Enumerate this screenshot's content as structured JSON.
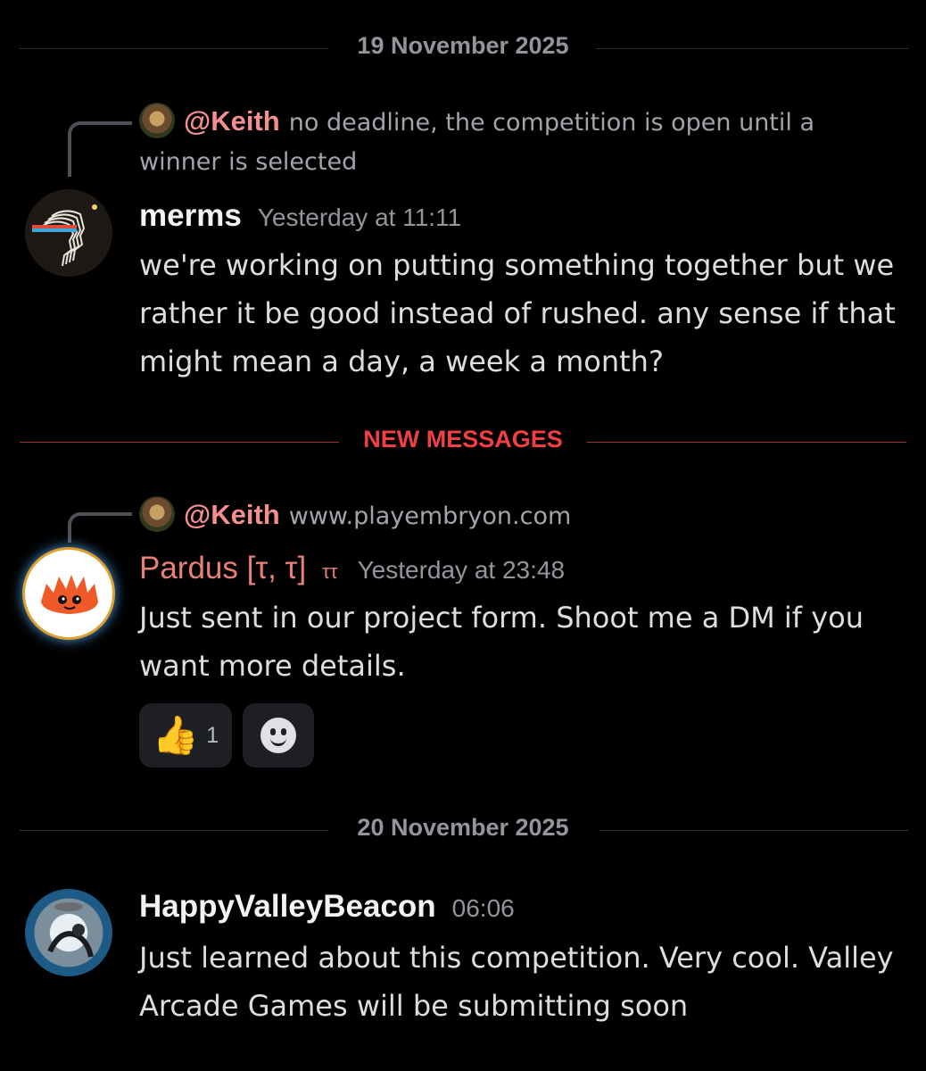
{
  "dividers": {
    "date1": "19 November 2025",
    "new": "NEW MESSAGES",
    "date2": "20 November 2025"
  },
  "messages": [
    {
      "reply_to": {
        "mention": "@Keith",
        "text": "no deadline, the competition is open until a winner is selected"
      },
      "author": "merms",
      "timestamp": "Yesterday at 11:11",
      "content": "we're working on putting something together but we rather it be good instead of rushed. any sense if that might mean a day, a week a month?"
    },
    {
      "reply_to": {
        "mention": "@Keith",
        "text": "www.playembryon.com"
      },
      "author": "Pardus [τ, τ]",
      "tag": "ττ",
      "timestamp": "Yesterday at 23:48",
      "content": "Just sent in our project form. Shoot me a DM if you want more details.",
      "reactions": [
        {
          "emoji": "👍",
          "count": "1"
        }
      ]
    },
    {
      "author": "HappyValleyBeacon",
      "timestamp": "06:06",
      "content": "Just learned about this competition. Very cool. Valley Arcade Games will be submitting soon"
    }
  ]
}
